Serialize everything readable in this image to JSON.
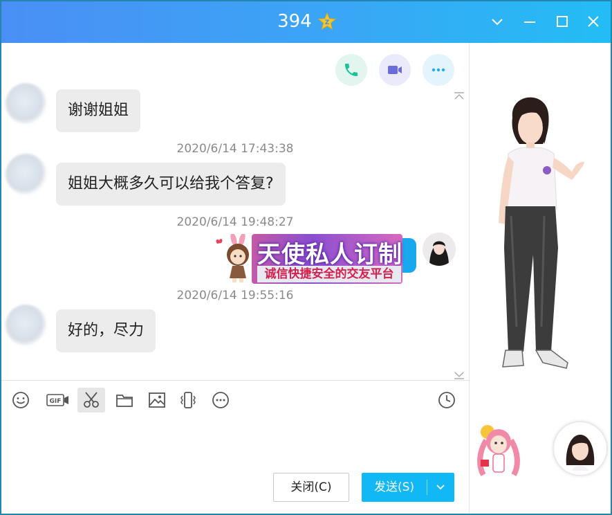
{
  "window": {
    "title": "394",
    "badge_icon": "vip-crown-icon"
  },
  "window_controls": [
    "chevron-down-icon",
    "minimize-icon",
    "maximize-icon",
    "close-icon"
  ],
  "call_actions": [
    "phone-call-icon",
    "video-call-icon",
    "more-icon"
  ],
  "messages": [
    {
      "type": "text",
      "side": "left",
      "text": "谢谢姐姐"
    },
    {
      "type": "timestamp",
      "text": "2020/6/14 17:43:38"
    },
    {
      "type": "text",
      "side": "left",
      "text": "姐姐大概多久可以给我个答复?"
    },
    {
      "type": "timestamp",
      "text": "2020/6/14 19:48:27"
    },
    {
      "type": "sticker",
      "side": "right",
      "title": "天使私人订制",
      "subtitle": "诚信快捷安全的交友平台"
    },
    {
      "type": "timestamp",
      "text": "2020/6/14 19:55:16"
    },
    {
      "type": "text",
      "side": "left",
      "text": "好的，尽力"
    }
  ],
  "toolbar": [
    "emoji-icon",
    "gif-icon",
    "screenshot-scissors-icon",
    "folder-icon",
    "image-icon",
    "shake-icon",
    "more-icon",
    "history-clock-icon"
  ],
  "actions": {
    "close_label": "关闭(C)",
    "send_label": "发送(S)"
  },
  "colors": {
    "title_gradient_start": "#4a8ff5",
    "title_gradient_end": "#23bdf5",
    "send_button": "#12b7f5",
    "bubble_left": "#ececec",
    "bubble_right": "#19a8ee",
    "timestamp": "#8a8a8a"
  }
}
